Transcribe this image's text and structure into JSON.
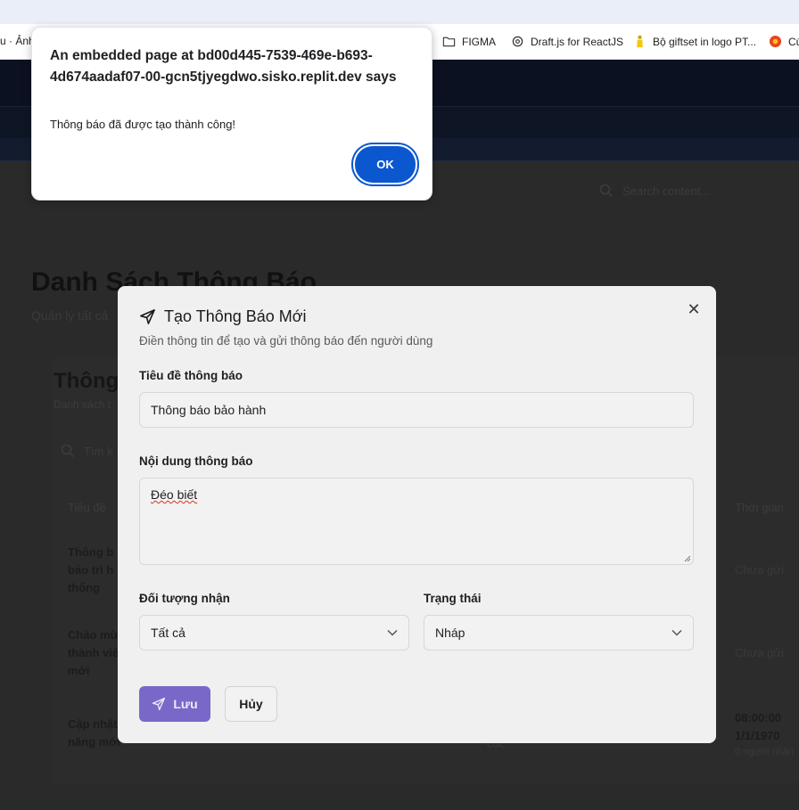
{
  "browser": {
    "bookmarks": [
      {
        "label": "u · Ảnh",
        "icon": "page-icon"
      },
      {
        "label": "FIGMA",
        "icon": "folder-icon"
      },
      {
        "label": "Draft.js for ReactJS",
        "icon": "openai-icon"
      },
      {
        "label": "Bộ giftset in logo PT...",
        "icon": "bottle-icon"
      },
      {
        "label": "Cú",
        "icon": "site-icon"
      }
    ]
  },
  "background": {
    "search_placeholder": "Search content...",
    "page_title": "Danh Sách Thông Báo",
    "page_subtitle": "Quản lý tất cả",
    "card_title": "Thông",
    "card_subtitle": "Danh sách t",
    "table_search_placeholder": "Tìm k",
    "columns": {
      "title": "Tiêu đề",
      "time": "Thời gian"
    },
    "rows": [
      {
        "title_lines": [
          "Thông b",
          "bảo trì h",
          "thống"
        ],
        "time": "Chưa gửi"
      },
      {
        "title_lines": [
          "Chào mừ",
          "thành viê",
          "mới"
        ],
        "time": "Chưa gửi"
      },
      {
        "title_lines": [
          "Cập nhật",
          "năng mới"
        ],
        "extra": "cục",
        "time_lines": [
          "08:00:00",
          "1/1/1970"
        ],
        "recipients": "0 người nhận"
      }
    ]
  },
  "modal": {
    "title": "Tạo Thông Báo Mới",
    "description": "Điền thông tin để tạo và gửi thông báo đến người dùng",
    "title_label": "Tiêu đề thông báo",
    "title_value": "Thông báo bảo hành",
    "content_label": "Nội dung thông báo",
    "content_value": "Đéo biết",
    "recipient_label": "Đối tượng nhận",
    "recipient_value": "Tất cả",
    "status_label": "Trạng thái",
    "status_value": "Nháp",
    "save_label": "Lưu",
    "cancel_label": "Hủy",
    "accent_color": "#7a68c9"
  },
  "alert": {
    "title": "An embedded page at bd00d445-7539-469e-b693-4d674aadaf07-00-gcn5tjyegdwo.sisko.replit.dev says",
    "message": "Thông báo đã được tạo thành công!",
    "ok_label": "OK",
    "button_color": "#0b57d0"
  }
}
